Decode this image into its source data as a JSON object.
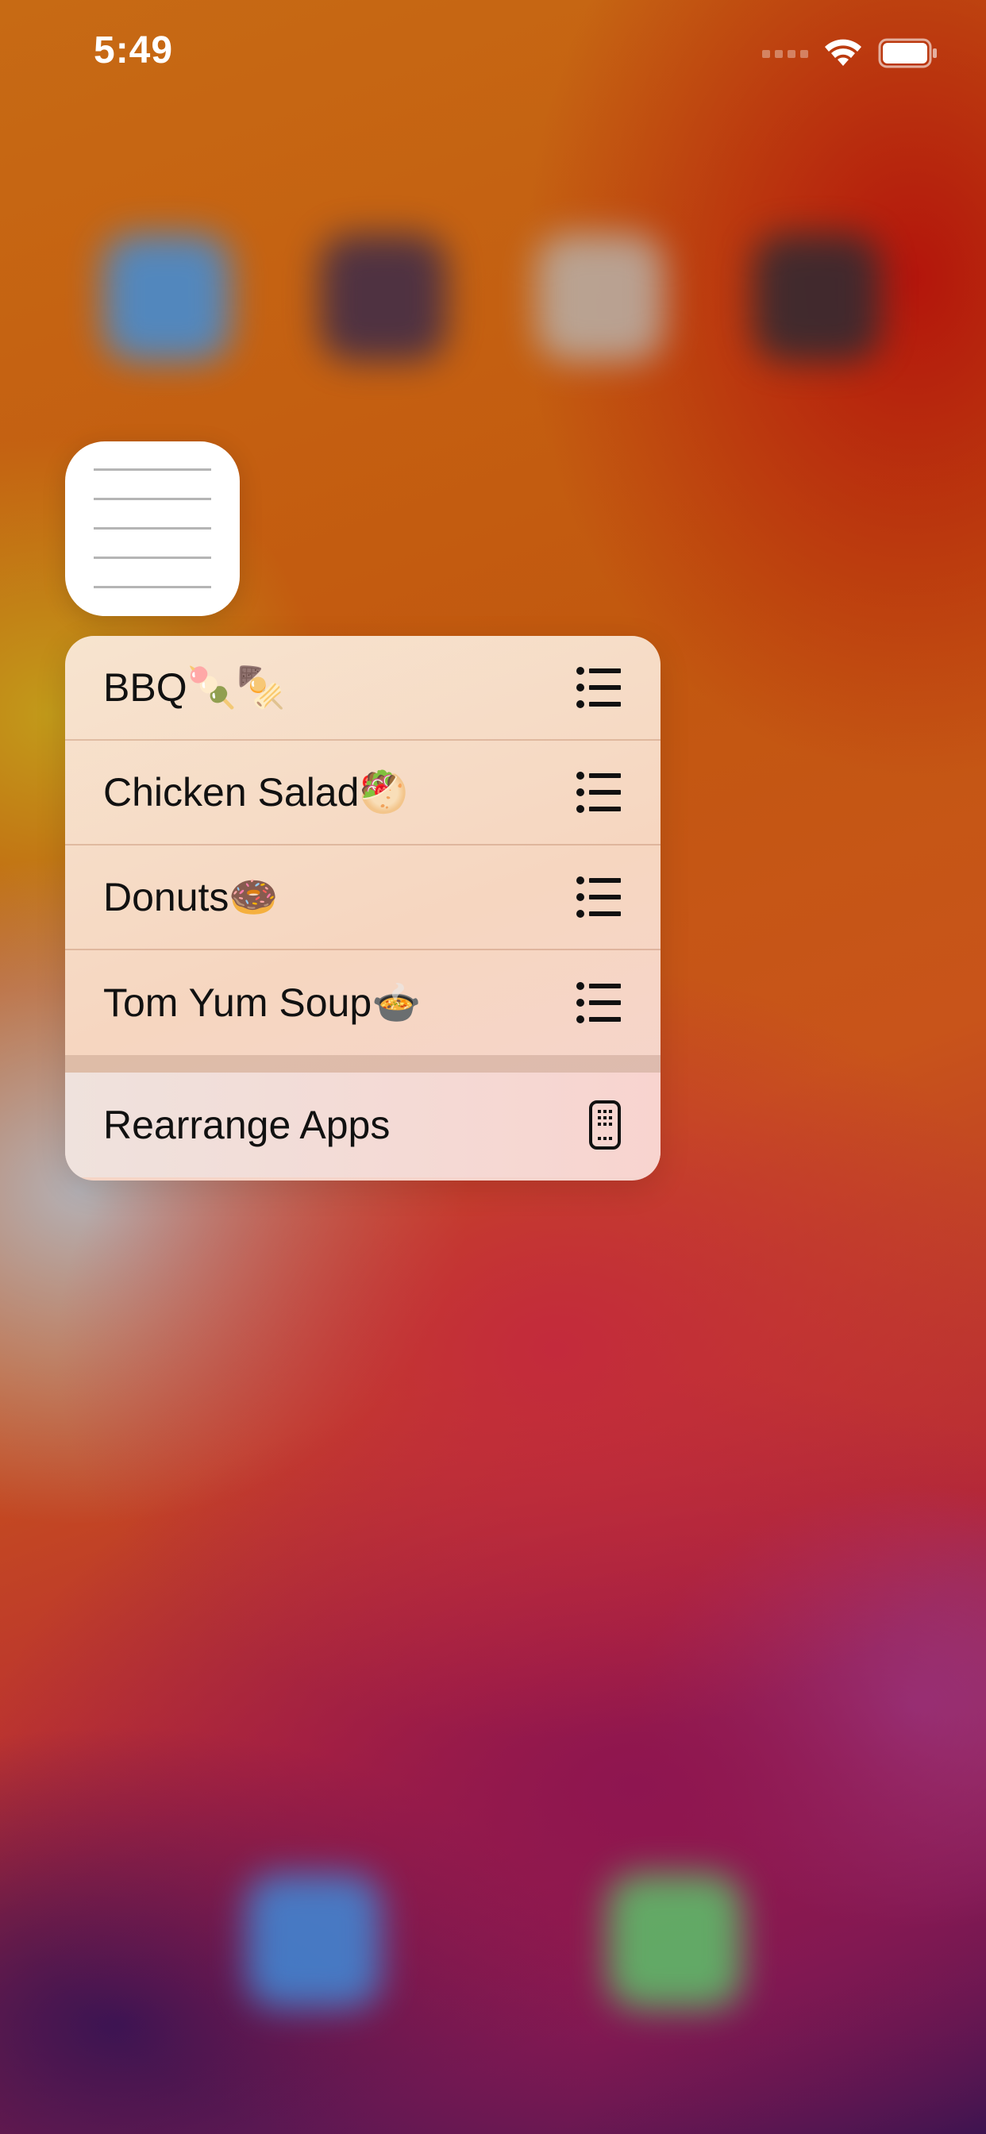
{
  "status_bar": {
    "time": "5:49"
  },
  "app": {
    "icon_name": "notes-list-icon"
  },
  "quick_actions": [
    {
      "label": "BBQ🍡🍢",
      "icon": "list-icon"
    },
    {
      "label": "Chicken Salad🥙",
      "icon": "list-icon"
    },
    {
      "label": "Donuts🍩",
      "icon": "list-icon"
    },
    {
      "label": "Tom Yum Soup🍲",
      "icon": "list-icon"
    }
  ],
  "system_actions": [
    {
      "label": "Rearrange Apps",
      "icon": "phone-grid-icon"
    }
  ],
  "colors": {
    "wallpaper_top": "#c76a14",
    "wallpaper_red": "#b3150c",
    "wallpaper_bottom": "#3d1450",
    "menu_background": "#f6d6c0"
  }
}
